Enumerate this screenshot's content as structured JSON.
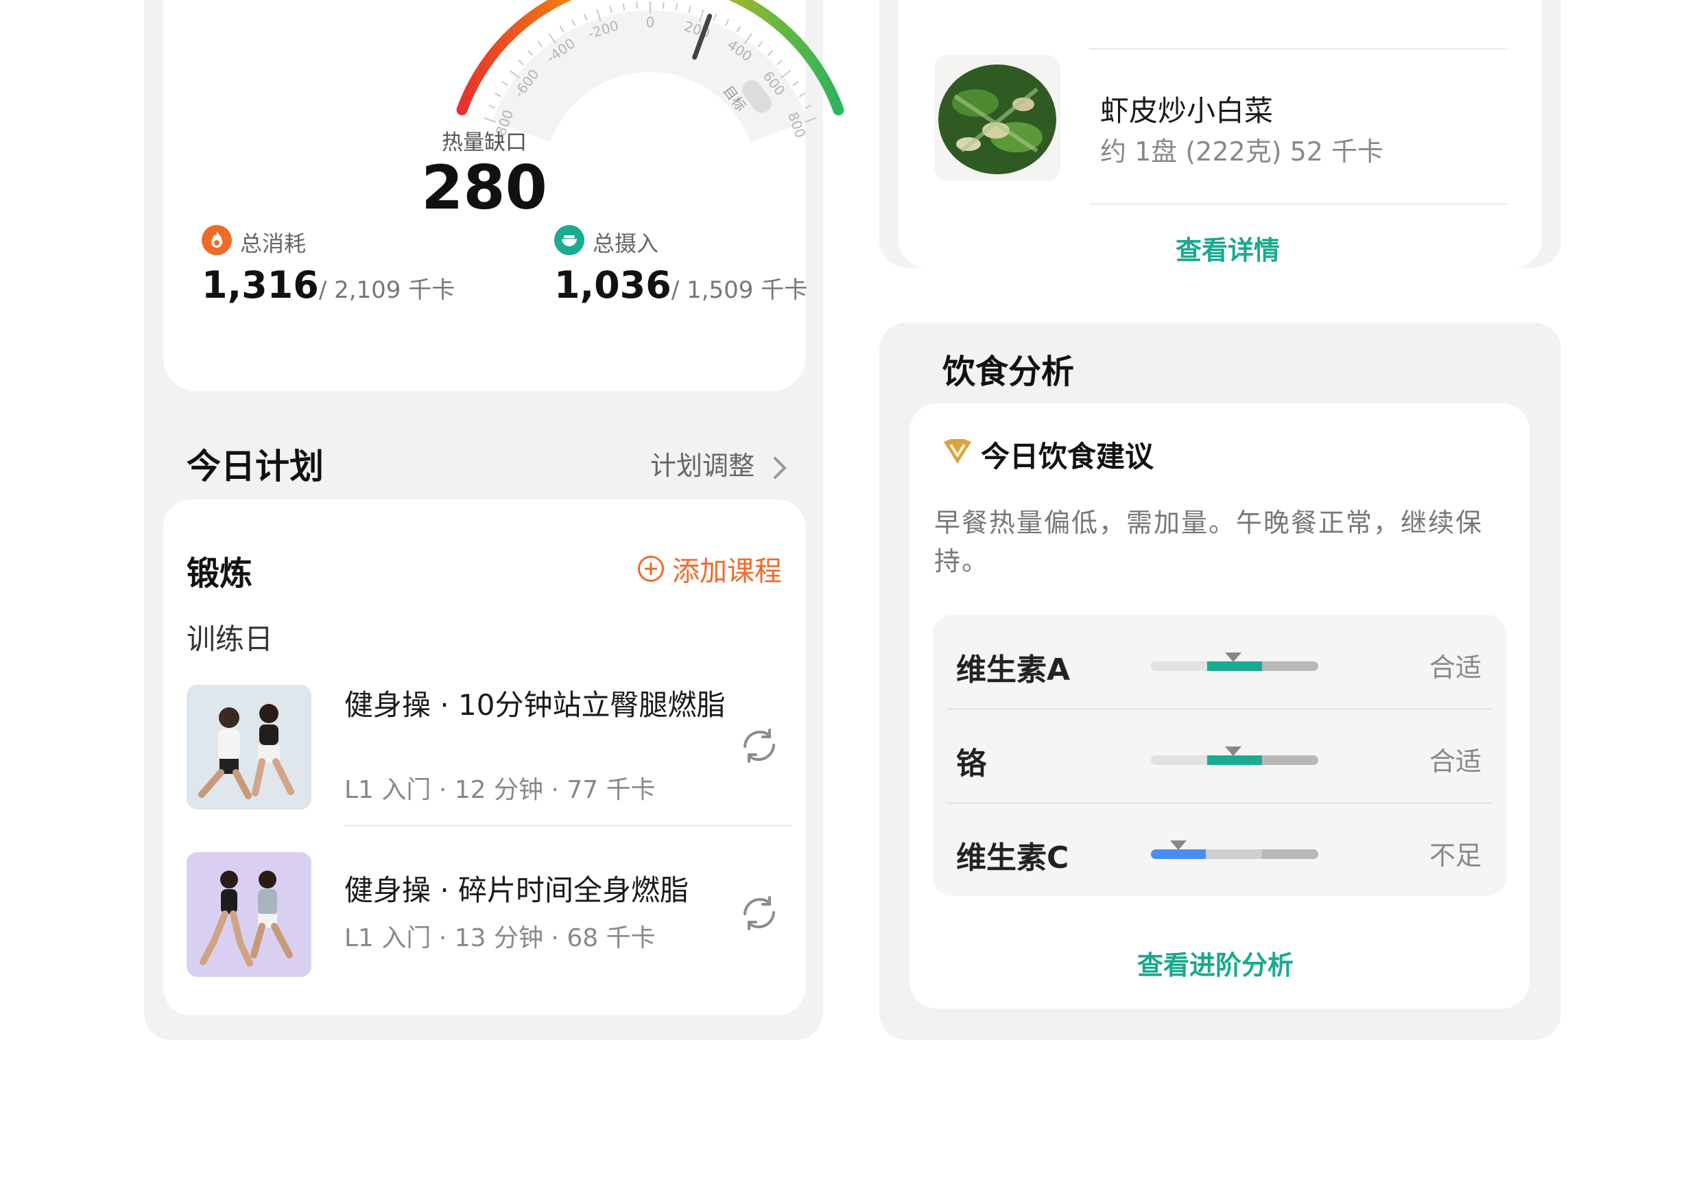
{
  "calorie_gauge": {
    "title": "热量缺口",
    "value": "280",
    "scale_labels": [
      "-800",
      "-600",
      "-400",
      "-200",
      "0",
      "200",
      "400",
      "600",
      "800"
    ],
    "target_label": "目标",
    "needle_value": 230,
    "range": [
      -800,
      800
    ],
    "colors": {
      "start": "#e8322c",
      "mid": "#f5b800",
      "end": "#2bb55e",
      "needle": "#444444"
    }
  },
  "stats": {
    "burn": {
      "label": "总消耗",
      "value": "1,316",
      "goal": "/ 2,109 千卡",
      "icon": "flame-icon",
      "color": "#f06a28"
    },
    "intake": {
      "label": "总摄入",
      "value": "1,036",
      "goal": "/ 1,509 千卡",
      "icon": "bowl-icon",
      "color": "#1aab91"
    }
  },
  "plan": {
    "title": "今日计划",
    "adjust_label": "计划调整"
  },
  "exercise": {
    "title": "锻炼",
    "add_label": "添加课程",
    "day_label": "训练日",
    "courses": [
      {
        "title": "健身操 · 10分钟站立臀腿燃脂",
        "meta": "L1 入门 · 12 分钟 · 77 千卡"
      },
      {
        "title": "健身操 · 碎片时间全身燃脂",
        "meta": "L1 入门 · 13 分钟 · 68 千卡"
      }
    ]
  },
  "food": {
    "item_name": "虾皮炒小白菜",
    "item_meta": "约 1盘 (222克) 52 千卡",
    "details_link": "查看详情"
  },
  "diet_analysis": {
    "title": "饮食分析",
    "advice_title": "今日饮食建议",
    "advice_icon": "premium-v-icon",
    "advice_text": "早餐热量偏低，需加量。午晚餐正常，继续保持。",
    "nutrients": [
      {
        "name": "维生素A",
        "status": "合适",
        "level": "normal"
      },
      {
        "name": "铬",
        "status": "合适",
        "level": "normal"
      },
      {
        "name": "维生素C",
        "status": "不足",
        "level": "low"
      }
    ],
    "advanced_link": "查看进阶分析",
    "colors": {
      "normal": "#1aab91",
      "low": "#4a8ff0",
      "track": "#dcdcdc"
    }
  }
}
